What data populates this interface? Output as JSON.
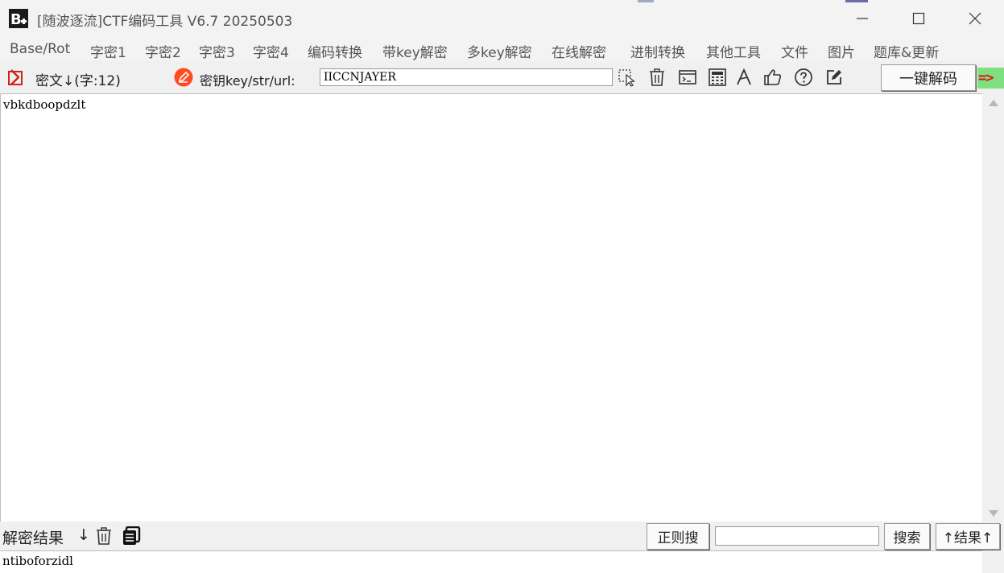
{
  "window": {
    "title": "[随波逐流]CTF编码工具 V6.7  20250503"
  },
  "menu": [
    {
      "label": "Base/Rot"
    },
    {
      "label": "字密1"
    },
    {
      "label": "字密2"
    },
    {
      "label": "字密3"
    },
    {
      "label": "字密4"
    },
    {
      "label": "编码转换"
    },
    {
      "label": "带key解密"
    },
    {
      "label": "多key解密"
    },
    {
      "label": "在线解密"
    },
    {
      "label": "进制转换"
    },
    {
      "label": "其他工具"
    },
    {
      "label": "文件"
    },
    {
      "label": "图片"
    },
    {
      "label": "题库&更新"
    }
  ],
  "toolbar": {
    "cipher_label": "密文↓(字:12)",
    "key_label": "密钥key/str/url:",
    "key_value": "IICCNJAYER",
    "decode_all_label": "一键解码",
    "arrow_indicator": "=>",
    "icons": [
      "cursor-select-icon",
      "trash-icon",
      "terminal-icon",
      "calculator-icon",
      "font-icon",
      "thumbs-up-icon",
      "help-icon",
      "edit-icon"
    ]
  },
  "cipher": {
    "text": "vbkdboopdzlt"
  },
  "result_bar": {
    "label": "解密结果",
    "down_arrow": "↓",
    "regex_search_label": "正则搜",
    "search_value": "",
    "search_label": "搜索",
    "result_up_label": "↑结果↑"
  },
  "result": {
    "text": "ntiboforzidl"
  }
}
